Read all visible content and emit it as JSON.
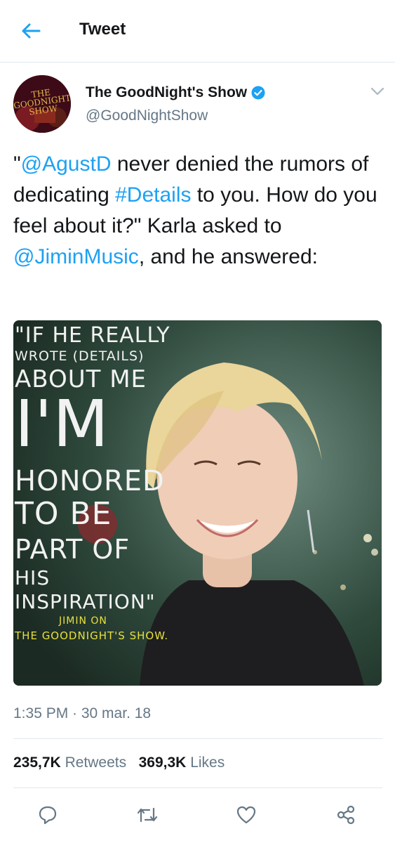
{
  "header": {
    "title": "Tweet",
    "back_icon": "arrow-left-icon"
  },
  "tweet": {
    "author": {
      "display_name": "The GoodNight's Show",
      "handle": "@GoodNightShow",
      "avatar_text": "THE GOODNIGHT'S SHOW",
      "verified": true
    },
    "text": {
      "q_open": "\"",
      "mention1": "@AgustD",
      "t1": " never denied the rumors of dedicating ",
      "hashtag": "#Details",
      "t2": " to you. How do you feel about it?\" Karla asked to ",
      "mention2": "@JiminMusic",
      "t3": ", and he answered:"
    },
    "media": {
      "quote_lines": [
        "\"IF HE REALLY",
        "WROTE (DETAILS)",
        "ABOUT ME",
        "I'M",
        "HONORED",
        "TO BE",
        "PART OF",
        "HIS",
        "INSPIRATION\""
      ],
      "caption_line1": "JIMIN ON",
      "caption_line2": "THE GOODNIGHT'S SHOW."
    },
    "timestamp": "1:35 PM · 30 mar. 18",
    "stats": {
      "retweets_count": "235,7K",
      "retweets_label": "Retweets",
      "likes_count": "369,3K",
      "likes_label": "Likes"
    }
  },
  "actions": [
    "reply-icon",
    "retweet-icon",
    "like-icon",
    "share-icon"
  ],
  "colors": {
    "link": "#1da1f2",
    "secondary": "#657786",
    "divider": "#e1e8ed"
  }
}
